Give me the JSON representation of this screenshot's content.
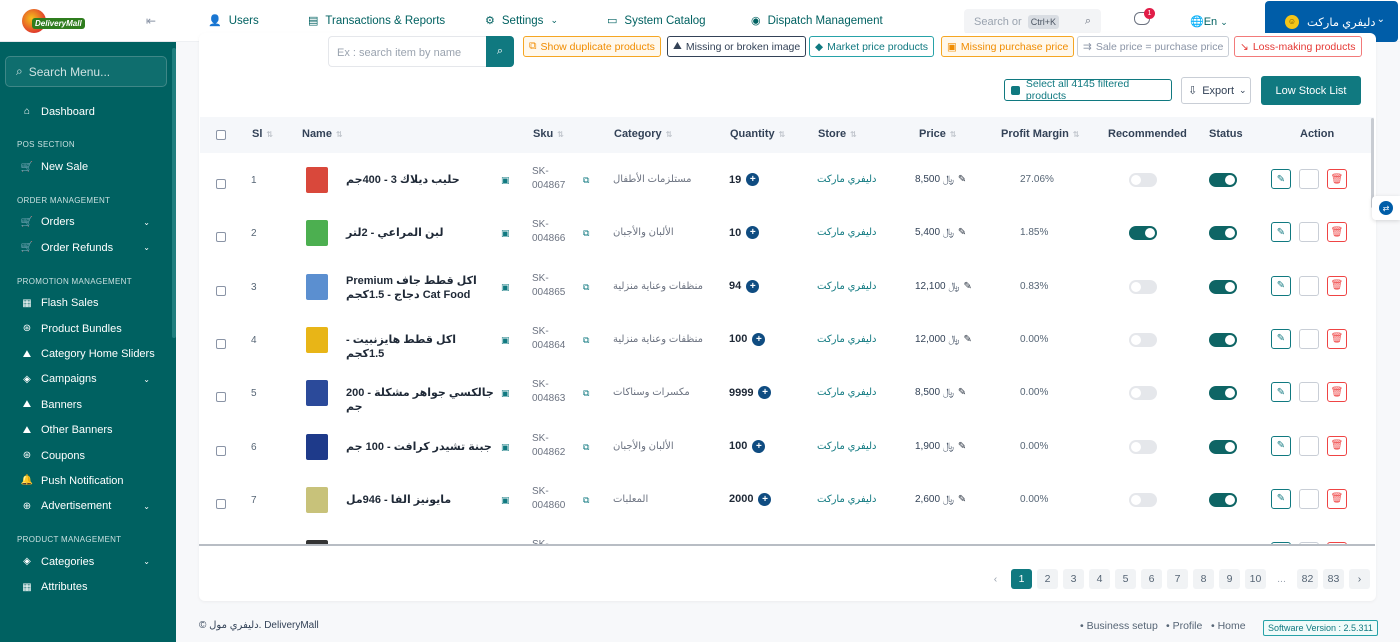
{
  "sidebar": {
    "search_placeholder": "Search Menu...",
    "items": [
      {
        "label": "Dashboard"
      },
      {
        "section": "POS SECTION"
      },
      {
        "label": "New Sale"
      },
      {
        "section": "ORDER MANAGEMENT"
      },
      {
        "label": "Orders"
      },
      {
        "label": "Order Refunds"
      },
      {
        "section": "PROMOTION MANAGEMENT"
      },
      {
        "label": "Flash Sales"
      },
      {
        "label": "Product Bundles"
      },
      {
        "label": "Category Home Sliders"
      },
      {
        "label": "Campaigns"
      },
      {
        "label": "Banners"
      },
      {
        "label": "Other Banners"
      },
      {
        "label": "Coupons"
      },
      {
        "label": "Push Notification"
      },
      {
        "label": "Advertisement"
      },
      {
        "section": "PRODUCT MANAGEMENT"
      },
      {
        "label": "Categories"
      },
      {
        "label": "Attributes"
      }
    ]
  },
  "brand": {
    "logo_text": "DeliveryMall"
  },
  "header": {
    "nav": [
      {
        "label": "Users",
        "icon": "user-icon"
      },
      {
        "label": "Transactions & Reports",
        "icon": "report-icon"
      },
      {
        "label": "Settings",
        "icon": "gear-icon"
      },
      {
        "label": "System Catalog",
        "icon": "book-icon"
      },
      {
        "label": "Dispatch Management",
        "icon": "dispatch-icon"
      }
    ],
    "search_placeholder": "Search or",
    "search_shortcut": "Ctrl+K",
    "notification_count": "1",
    "language": "En",
    "store_name": "دليفري ماركت"
  },
  "toolbar": {
    "search_placeholder": "Ex : search item by name",
    "filters": [
      "Show duplicate products",
      "Missing or broken image",
      "Market price products",
      "Missing purchase price",
      "Sale price = purchase price",
      "Loss-making products"
    ],
    "select_all": "Select all 4145 filtered products",
    "export": "Export",
    "low_stock": "Low Stock List"
  },
  "table": {
    "columns": [
      "Sl",
      "Name",
      "Sku",
      "Category",
      "Quantity",
      "Store",
      "Price",
      "Profit Margin",
      "Recommended",
      "Status",
      "Action"
    ],
    "rows": [
      {
        "sl": "1",
        "name": "حليب ديلاك 3 - 400جم",
        "sku": "SK-004867",
        "category": "مستلزمات الأطفال",
        "quantity": "19",
        "store": "دليفري ماركت",
        "price": "8,500 ﷼",
        "margin": "27.06%",
        "recommended": false,
        "status": true,
        "img": "#d9483b"
      },
      {
        "sl": "2",
        "name": "لبن المراعي - 2لتر",
        "sku": "SK-004866",
        "category": "الألبان والأجبان",
        "quantity": "10",
        "store": "دليفري ماركت",
        "price": "5,400 ﷼",
        "margin": "1.85%",
        "recommended": true,
        "status": true,
        "img": "#4caf50"
      },
      {
        "sl": "3",
        "name": "اكل قطط جاف Premium Cat Food دجاج - 1.5كجم",
        "sku": "SK-004865",
        "category": "منظفات وعناية منزلية",
        "quantity": "94",
        "store": "دليفري ماركت",
        "price": "12,100 ﷼",
        "margin": "0.83%",
        "recommended": false,
        "status": true,
        "img": "#5b8fd0"
      },
      {
        "sl": "4",
        "name": "اكل قطط هايزنبيت - 1.5كجم",
        "sku": "SK-004864",
        "category": "منظفات وعناية منزلية",
        "quantity": "100",
        "store": "دليفري ماركت",
        "price": "12,000 ﷼",
        "margin": "0.00%",
        "recommended": false,
        "status": true,
        "img": "#e8b517"
      },
      {
        "sl": "5",
        "name": "جالكسي جواهر مشكلة - 200 جم",
        "sku": "SK-004863",
        "category": "مكسرات وسناكات",
        "quantity": "9999",
        "store": "دليفري ماركت",
        "price": "8,500 ﷼",
        "margin": "0.00%",
        "recommended": false,
        "status": true,
        "img": "#2b4a9a"
      },
      {
        "sl": "6",
        "name": "جبنة تشيدر كرافت - 100 جم",
        "sku": "SK-004862",
        "category": "الألبان والأجبان",
        "quantity": "100",
        "store": "دليفري ماركت",
        "price": "1,900 ﷼",
        "margin": "0.00%",
        "recommended": false,
        "status": true,
        "img": "#1e3a8a"
      },
      {
        "sl": "7",
        "name": "مايونيز الفا - 946مل",
        "sku": "SK-004860",
        "category": "المعلبات",
        "quantity": "2000",
        "store": "دليفري ماركت",
        "price": "2,600 ﷼",
        "margin": "0.00%",
        "recommended": false,
        "status": true,
        "img": "#c8c27a"
      },
      {
        "sl": "",
        "name": "",
        "sku": "SK-",
        "category": "",
        "quantity": "",
        "store": "",
        "price": "",
        "margin": "",
        "recommended": false,
        "status": true,
        "img": "#333"
      }
    ]
  },
  "pagination": {
    "prev": "‹",
    "pages": [
      "1",
      "2",
      "3",
      "4",
      "5",
      "6",
      "7",
      "8",
      "9",
      "10",
      "...",
      "82",
      "83"
    ],
    "active": "1",
    "next": "›"
  },
  "footer": {
    "copyright": "© دليفري مول. DeliveryMall",
    "links": [
      "Business setup",
      "Profile",
      "Home"
    ],
    "version": "Software Version : 2.5.311"
  },
  "colors": {
    "primary": "#107980",
    "sidebar": "#006161",
    "store_button": "#005da8"
  }
}
